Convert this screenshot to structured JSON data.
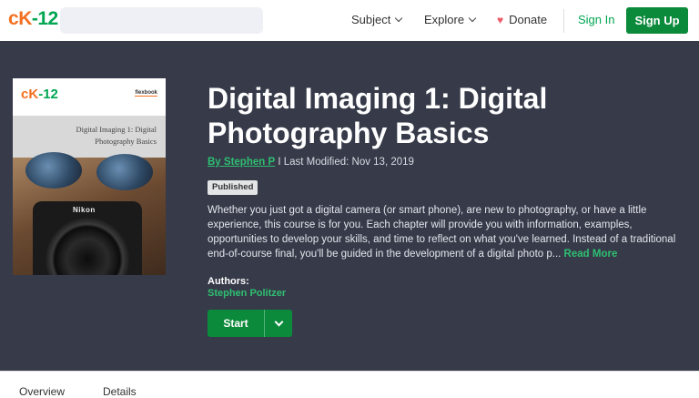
{
  "nav": {
    "logo": {
      "c": "c",
      "k": "K",
      "dash": "-",
      "num": "12"
    },
    "search_placeholder": "",
    "subject_label": "Subject",
    "explore_label": "Explore",
    "donate_label": "Donate",
    "signin_label": "Sign In",
    "signup_label": "Sign Up"
  },
  "cover": {
    "logo": {
      "c": "c",
      "k": "K",
      "dash": "-",
      "num": "12"
    },
    "flex_label": "flexbook",
    "title_line1": "Digital Imaging 1: Digital",
    "title_line2": "Photography Basics",
    "camera_brand": "Nikon"
  },
  "course": {
    "title": "Digital Imaging 1: Digital Photography Basics",
    "byline_prefix": "By Stephen P",
    "byline_suffix": " I Last Modified: Nov 13, 2019",
    "status": "Published",
    "description": "Whether you just got a digital camera (or smart phone), are new to photography, or have a little experience, this course is for you. Each chapter will provide you with information, examples, opportunities to develop your skills, and time to reflect on what you've learned. Instead of a traditional end-of-course final, you'll be guided in the development of a digital photo p...",
    "read_more": "Read More",
    "authors_label": "Authors:",
    "author_name": "Stephen Politzer",
    "start_label": "Start"
  },
  "tabs": [
    "Overview",
    "Details"
  ],
  "colors": {
    "brand_green": "#0c8a3c",
    "link_green": "#2fbf71",
    "hero_bg": "#363a49",
    "logo_orange": "#f37021"
  }
}
